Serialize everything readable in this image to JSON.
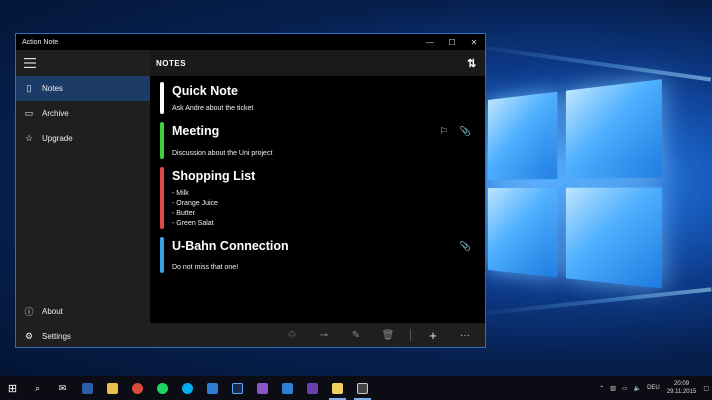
{
  "window": {
    "title": "Action Note",
    "controls": {
      "minimize": "—",
      "maximize": "☐",
      "close": "✕"
    }
  },
  "sidebar": {
    "items": [
      {
        "label": "Notes",
        "icon": "note-icon"
      },
      {
        "label": "Archive",
        "icon": "archive-icon"
      },
      {
        "label": "Upgrade",
        "icon": "star-icon"
      }
    ],
    "bottom": [
      {
        "label": "About",
        "icon": "info-icon"
      },
      {
        "label": "Settings",
        "icon": "gear-icon"
      }
    ]
  },
  "main": {
    "header": "NOTES",
    "notes": [
      {
        "title": "Quick Note",
        "body": "Ask Andre about the ticket",
        "color": "#ffffff"
      },
      {
        "title": "Meeting",
        "body": "Discussion about the Uni project",
        "color": "#3fcf3f"
      },
      {
        "title": "Shopping List",
        "body": "- Milk\n- Orange Juice\n- Butter\n- Green Salat",
        "color": "#e04848"
      },
      {
        "title": "U-Bahn Connection",
        "body": "Do not miss that one!",
        "color": "#3aa0e6"
      }
    ]
  },
  "taskbar": {
    "language": "DEU",
    "time": "20:09",
    "date": "29.11.2015"
  }
}
